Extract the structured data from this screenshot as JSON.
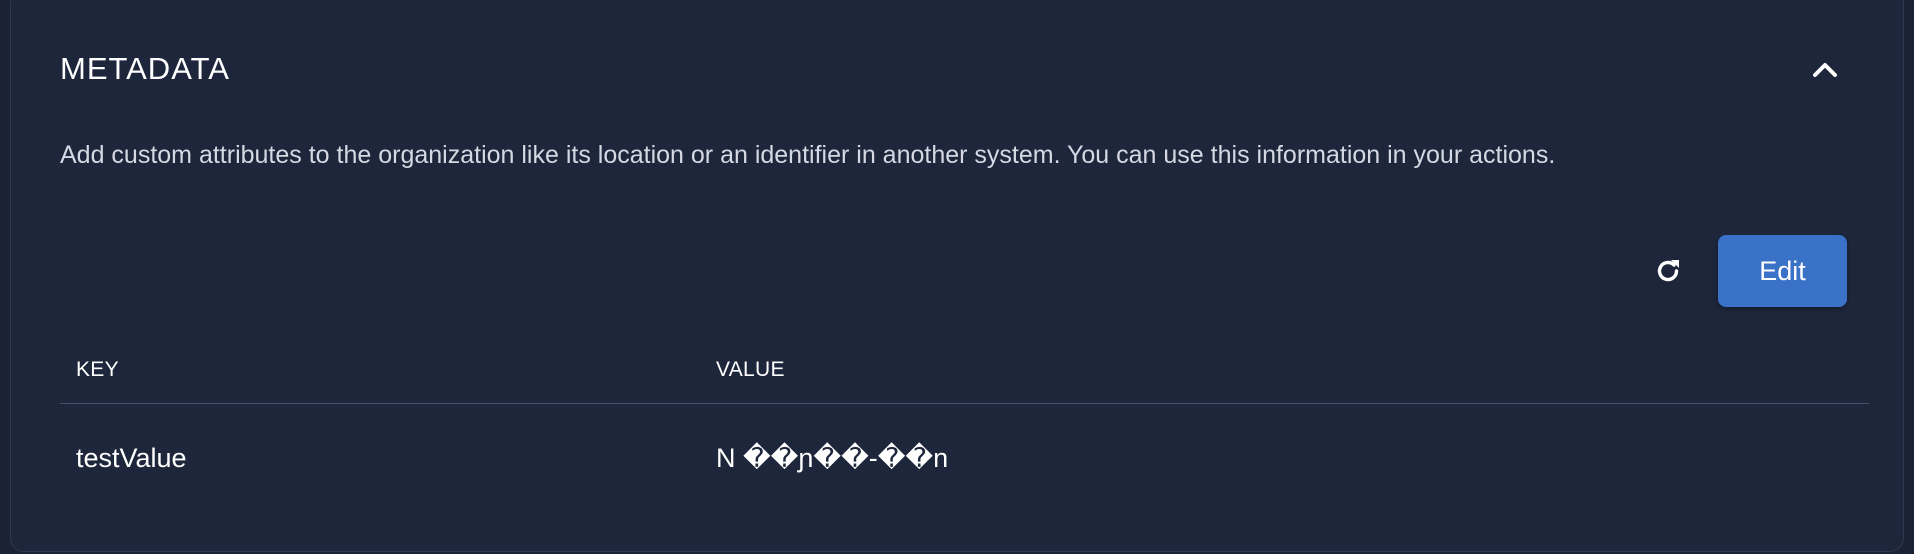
{
  "panel": {
    "title": "METADATA",
    "description": "Add custom attributes to the organization like its location or an identifier in another system. You can use this information in your actions.",
    "collapse_icon": "chevron-up-icon",
    "refresh_icon": "refresh-icon",
    "edit_label": "Edit"
  },
  "table": {
    "columns": [
      "KEY",
      "VALUE"
    ],
    "rows": [
      {
        "key": "testValue",
        "value": "N ��ɲ��-��n"
      }
    ]
  },
  "colors": {
    "background": "#1e263b",
    "accent": "#3a72c7"
  }
}
